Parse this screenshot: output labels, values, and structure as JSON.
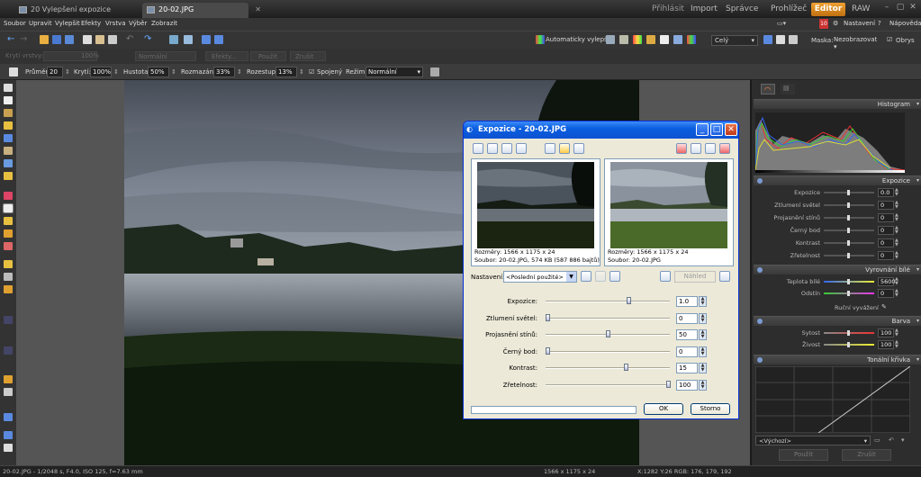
{
  "tabs": [
    {
      "label": "20 Vylepšení expozice"
    },
    {
      "label": "20-02.JPG"
    }
  ],
  "topnav": {
    "login": "Přihlásit",
    "import": "Import",
    "manager": "Správce",
    "viewer": "Prohlížeč",
    "editor": "Editor",
    "raw": "RAW"
  },
  "menu": [
    "Soubor",
    "Upravit",
    "Vylepšit",
    "Efekty",
    "Vrstva",
    "Výběr",
    "Zobrazit"
  ],
  "toolbar1": {
    "auto_enhance": "Automaticky vylepšit",
    "zoom": "Celý",
    "mask_label": "Maska:",
    "mask_value": "Nezobrazovat",
    "outline": "Obrys",
    "settings": "Nastavení",
    "help": "Nápověda",
    "badge": "10"
  },
  "toolbar2": {
    "layer_opacity": "Krytí vrstvy:",
    "opacity_val": "100%",
    "mode": "Normální",
    "effects": "Efekty...",
    "apply": "Použít",
    "undo": "Zrušit"
  },
  "toolbar3": {
    "diameter_label": "Průměr:",
    "diameter": "20",
    "opacity_label": "Krytí:",
    "opacity": "100%",
    "density_label": "Hustota:",
    "density": "50%",
    "blur_label": "Rozmazání:",
    "blur": "33%",
    "step_label": "Rozestup:",
    "step": "13%",
    "continuous": "Spojený",
    "mode_label": "Režim:",
    "mode": "Normální"
  },
  "panel": {
    "histogram": "Histogram",
    "exposure": "Expozice",
    "white_balance": "Vyrovnání bílé",
    "color": "Barva",
    "tone_curve": "Tonální křivka",
    "exp_rows": [
      {
        "label": "Expozice",
        "value": "0.0"
      },
      {
        "label": "Ztlumení světel",
        "value": "0"
      },
      {
        "label": "Projasnění stínů",
        "value": "0"
      },
      {
        "label": "Černý bod",
        "value": "0"
      },
      {
        "label": "Kontrast",
        "value": "0"
      },
      {
        "label": "Zřetelnost",
        "value": "0"
      }
    ],
    "wb_rows": [
      {
        "label": "Teplota bílé",
        "value": "5600"
      },
      {
        "label": "Odstín",
        "value": "0"
      }
    ],
    "manual_wb": "Ruční vyvážení",
    "color_rows": [
      {
        "label": "Sytost",
        "value": "100"
      },
      {
        "label": "Živost",
        "value": "100"
      }
    ],
    "preset": "<Výchozí>",
    "apply": "Použít",
    "undo": "Zrušit"
  },
  "dialog": {
    "title": "Expozice - 20-02.JPG",
    "left_info1": "Rozměry: 1566 x 1175 x 24",
    "left_info2": "Soubor: 20-02.JPG, 574 KB (587 886 bajtů)",
    "right_info1": "Rozměry: 1566 x 1175 x 24",
    "right_info2": "Soubor: 20-02.JPG",
    "settings_label": "Nastavení:",
    "settings_value": "<Poslední použité>",
    "preview": "Náhled",
    "sliders": [
      {
        "label": "Expozice:",
        "value": "1.0",
        "pos": 0.67
      },
      {
        "label": "Ztlumení světel:",
        "value": "0",
        "pos": 0.0
      },
      {
        "label": "Projasnění stínů:",
        "value": "50",
        "pos": 0.5
      },
      {
        "label": "Černý bod:",
        "value": "0",
        "pos": 0.0
      },
      {
        "label": "Kontrast:",
        "value": "15",
        "pos": 0.65
      },
      {
        "label": "Zřetelnost:",
        "value": "100",
        "pos": 1.0
      }
    ],
    "ok": "OK",
    "cancel": "Storno"
  },
  "status": {
    "left": "20-02.JPG - 1/2048 s, F4.0, ISO 125, f=7.63 mm",
    "center": "1566 x 1175 x 24",
    "right": "X:1282 Y:26  RGB: 176, 179, 192"
  }
}
